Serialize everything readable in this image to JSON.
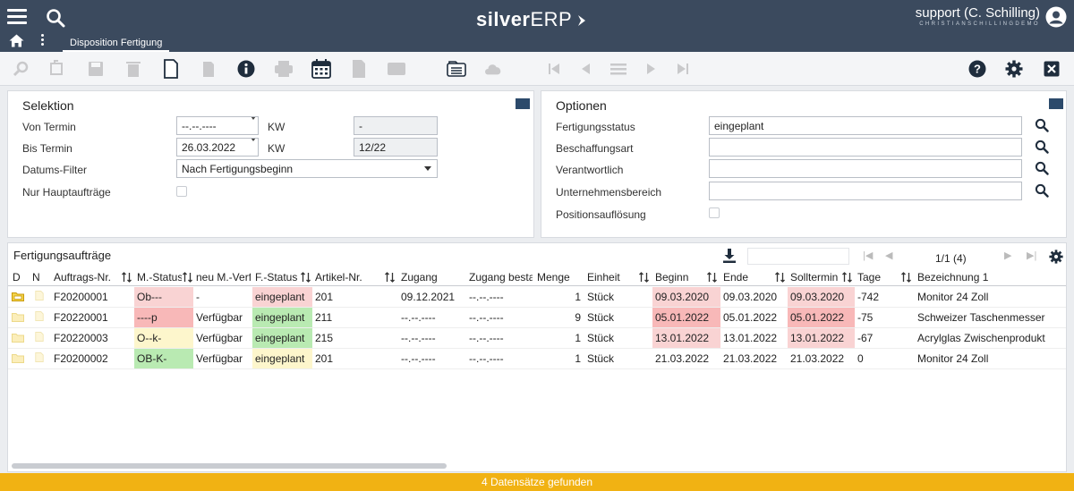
{
  "header": {
    "logo_bold": "silver",
    "logo_light": "ERP",
    "tab_label": "Disposition Fertigung",
    "user_name": "support (C. Schilling)",
    "user_company": "CHRISTIANSCHILLINGDEMO",
    "bg_color": "#3b4a5e"
  },
  "toolbar": {
    "icons": [
      "search-icon",
      "undo-icon",
      "save-icon",
      "delete-icon",
      "new-document-icon",
      "copy-icon",
      "info-icon",
      "print-icon",
      "calendar-icon",
      "document-icon",
      "email-icon",
      "list-icon",
      "cloud-icon",
      "first-page-icon",
      "previous-icon",
      "menu-icon",
      "next-icon",
      "last-page-icon",
      "help-icon",
      "gear-icon",
      "close-icon"
    ]
  },
  "selektion": {
    "title": "Selektion",
    "von_termin_label": "Von Termin",
    "von_termin_value": "--.--.----",
    "kw_label_1": "KW",
    "kw_value_1": "-",
    "bis_termin_label": "Bis Termin",
    "bis_termin_value": "26.03.2022",
    "kw_label_2": "KW",
    "kw_value_2": "12/22",
    "datums_filter_label": "Datums-Filter",
    "datums_filter_value": "Nach Fertigungsbeginn",
    "nur_haupt_label": "Nur Hauptaufträge"
  },
  "optionen": {
    "title": "Optionen",
    "fertigungsstatus_label": "Fertigungsstatus",
    "fertigungsstatus_value": "eingeplant",
    "beschaffungsart_label": "Beschaffungsart",
    "verantwortlich_label": "Verantwortlich",
    "unternehmensbereich_label": "Unternehmensbereich",
    "positionsaufloesung_label": "Positionsauflösung"
  },
  "grid": {
    "title": "Fertigungsaufträge",
    "pager": "1/1 (4)",
    "columns": [
      "D",
      "N",
      "Auftrags-Nr.",
      "M.-Status",
      "neu M.-Verf.",
      "F.-Status",
      "Artikel-Nr.",
      "Zugang",
      "Zugang besta",
      "Menge",
      "Einheit",
      "Beginn",
      "Ende",
      "Solltermin",
      "Tage",
      "Bezeichnung 1"
    ],
    "rows": [
      {
        "auftrag": "F20200001",
        "mstatus": "Ob---",
        "neu": "-",
        "fstatus": "eingeplant",
        "artikel": "201",
        "zugang": "09.12.2021",
        "zugang_b": "--.--.----",
        "menge": "1",
        "einheit": "Stück",
        "beginn": "09.03.2020",
        "ende": "09.03.2020",
        "soll": "09.03.2020",
        "tage": "-742",
        "bez": "Monitor 24 Zoll",
        "mcolor": "#f9d3d3",
        "fcolor": "#f9d3d3",
        "bcolor": "#f9d3d3",
        "scolor": "#f9d3d3"
      },
      {
        "auftrag": "F20220001",
        "mstatus": "----p",
        "neu": "Verfügbar",
        "fstatus": "eingeplant",
        "artikel": "211",
        "zugang": "--.--.----",
        "zugang_b": "--.--.----",
        "menge": "9",
        "einheit": "Stück",
        "beginn": "05.01.2022",
        "ende": "05.01.2022",
        "soll": "05.01.2022",
        "tage": "-75",
        "bez": "Schweizer Taschenmesser",
        "mcolor": "#f8b8b8",
        "fcolor": "#b9eab2",
        "bcolor": "#f8b8b8",
        "scolor": "#f8b8b8"
      },
      {
        "auftrag": "F20220003",
        "mstatus": "O--k-",
        "neu": "Verfügbar",
        "fstatus": "eingeplant",
        "artikel": "215",
        "zugang": "--.--.----",
        "zugang_b": "--.--.----",
        "menge": "1",
        "einheit": "Stück",
        "beginn": "13.01.2022",
        "ende": "13.01.2022",
        "soll": "13.01.2022",
        "tage": "-67",
        "bez": "Acrylglas Zwischenprodukt",
        "mcolor": "#fdf6cc",
        "fcolor": "#b9eab2",
        "bcolor": "#f9d3d3",
        "scolor": "#f9d3d3"
      },
      {
        "auftrag": "F20200002",
        "mstatus": "OB-K-",
        "neu": "Verfügbar",
        "fstatus": "eingeplant",
        "artikel": "201",
        "zugang": "--.--.----",
        "zugang_b": "--.--.----",
        "menge": "1",
        "einheit": "Stück",
        "beginn": "21.03.2022",
        "ende": "21.03.2022",
        "soll": "21.03.2022",
        "tage": "0",
        "bez": "Monitor 24 Zoll",
        "mcolor": "#b9eab2",
        "fcolor": "#fdf6cc",
        "bcolor": "",
        "scolor": ""
      }
    ]
  },
  "footer": {
    "status": "4 Datensätze gefunden",
    "color": "#f1b213"
  }
}
